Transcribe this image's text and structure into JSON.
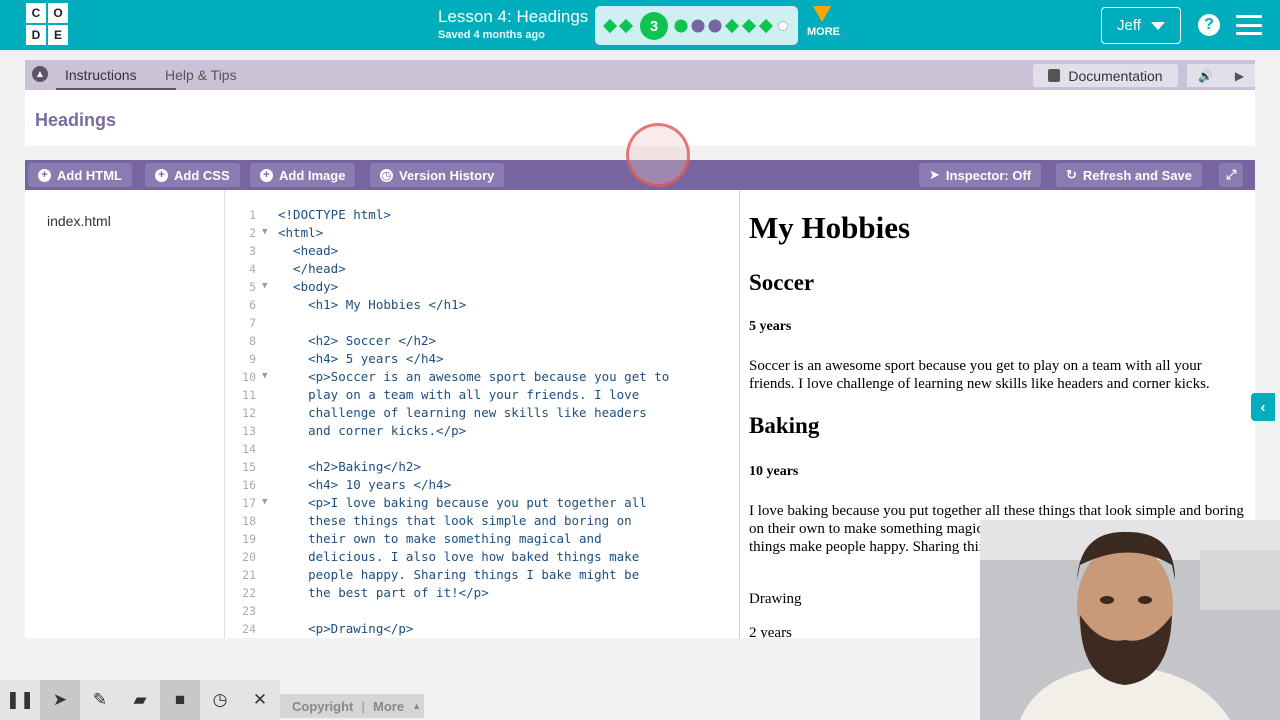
{
  "header": {
    "logo_letters": [
      "C",
      "O",
      "D",
      "E"
    ],
    "lesson_title": "Lesson 4: Headings",
    "saved_text": "Saved 4 months ago",
    "current_level": "3",
    "more_label": "MORE",
    "user_name": "Jeff",
    "help_label": "?"
  },
  "instructions": {
    "tab_instructions": "Instructions",
    "tab_help": "Help & Tips",
    "documentation_label": "Documentation",
    "title": "Headings"
  },
  "toolbar": {
    "add_html": "Add HTML",
    "add_css": "Add CSS",
    "add_image": "Add Image",
    "version_history": "Version History",
    "inspector": "Inspector: Off",
    "refresh_save": "Refresh and Save"
  },
  "files": {
    "items": [
      "index.html"
    ]
  },
  "editor": {
    "lines": [
      {
        "n": "1",
        "text": "<!DOCTYPE html>",
        "fold": false
      },
      {
        "n": "2",
        "text": "<html>",
        "fold": true
      },
      {
        "n": "3",
        "text": "  <head>",
        "fold": false
      },
      {
        "n": "4",
        "text": "  </head>",
        "fold": false
      },
      {
        "n": "5",
        "text": "  <body>",
        "fold": true
      },
      {
        "n": "6",
        "text": "    <h1> My Hobbies </h1>",
        "fold": false
      },
      {
        "n": "7",
        "text": "",
        "fold": false
      },
      {
        "n": "8",
        "text": "    <h2> Soccer </h2>",
        "fold": false
      },
      {
        "n": "9",
        "text": "    <h4> 5 years </h4>",
        "fold": false
      },
      {
        "n": "10",
        "text": "    <p>Soccer is an awesome sport because you get to",
        "fold": true
      },
      {
        "n": "11",
        "text": "    play on a team with all your friends. I love",
        "fold": false
      },
      {
        "n": "12",
        "text": "    challenge of learning new skills like headers",
        "fold": false
      },
      {
        "n": "13",
        "text": "    and corner kicks.</p>",
        "fold": false
      },
      {
        "n": "14",
        "text": "",
        "fold": false
      },
      {
        "n": "15",
        "text": "    <h2>Baking</h2>",
        "fold": false
      },
      {
        "n": "16",
        "text": "    <h4> 10 years </h4>",
        "fold": false
      },
      {
        "n": "17",
        "text": "    <p>I love baking because you put together all",
        "fold": true
      },
      {
        "n": "18",
        "text": "    these things that look simple and boring on",
        "fold": false
      },
      {
        "n": "19",
        "text": "    their own to make something magical and",
        "fold": false
      },
      {
        "n": "20",
        "text": "    delicious. I also love how baked things make",
        "fold": false
      },
      {
        "n": "21",
        "text": "    people happy. Sharing things I bake might be",
        "fold": false
      },
      {
        "n": "22",
        "text": "    the best part of it!</p>",
        "fold": false
      },
      {
        "n": "23",
        "text": "",
        "fold": false
      },
      {
        "n": "24",
        "text": "    <p>Drawing</p>",
        "fold": false
      }
    ]
  },
  "preview": {
    "h1": "My Hobbies",
    "h2_soccer": "Soccer",
    "h4_soccer": "5 years",
    "p_soccer": "Soccer is an awesome sport because you get to play on a team with all your friends. I love challenge of learning new skills like headers and corner kicks.",
    "h2_baking": "Baking",
    "h4_baking": "10 years",
    "p_baking": "I love baking because you put together all these things that look simple and boring on their own to make something magical and delicious. I also love how baked things make people happy. Sharing things I bake might be the best part of it!",
    "p_drawing": "Drawing",
    "p_years": "2 years"
  },
  "footer": {
    "copyright": "Copyright",
    "more": "More"
  },
  "colors": {
    "header_bg": "#00adbc",
    "toolbar_bg": "#7665a0",
    "progress_green": "#0ec34f",
    "progress_purple": "#7665a0"
  }
}
